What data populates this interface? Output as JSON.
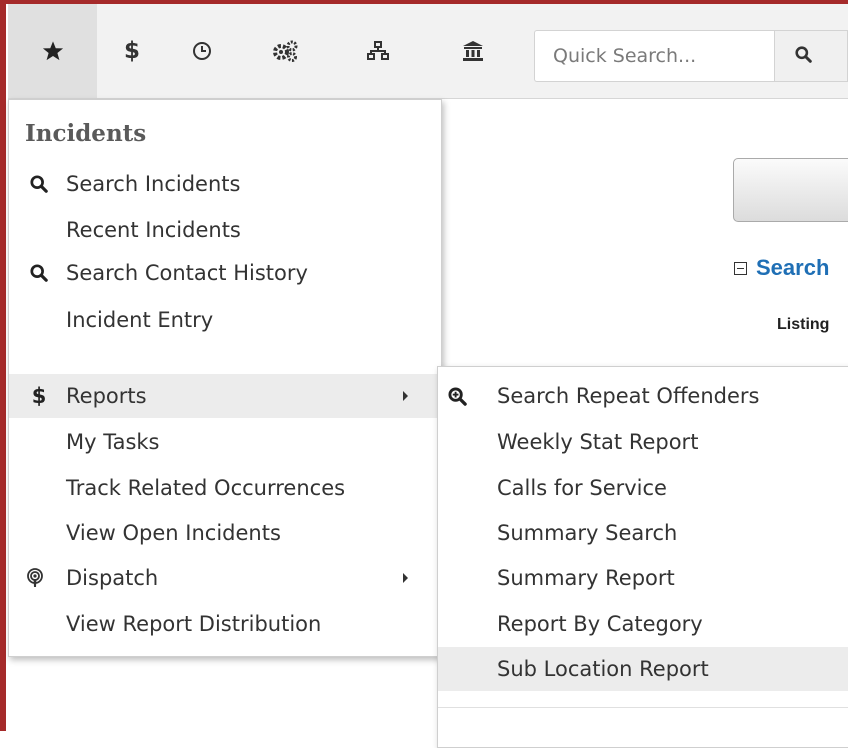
{
  "toolbar": {
    "icons": [
      "star-icon",
      "dollar-icon",
      "clock-icon",
      "cogs-icon",
      "sitemap-icon",
      "institution-icon"
    ],
    "search_placeholder": "Quick Search..."
  },
  "main_menu": {
    "header": "Incidents",
    "items": [
      {
        "label": "Search Incidents",
        "icon": "search-icon"
      },
      {
        "label": "Recent Incidents"
      },
      {
        "label": "Search Contact History",
        "icon": "search-icon"
      },
      {
        "label": "Incident Entry"
      },
      {
        "label": "Reports",
        "icon": "dollar-icon",
        "submenu": true,
        "highlighted": true
      },
      {
        "label": "My Tasks"
      },
      {
        "label": "Track Related Occurrences"
      },
      {
        "label": "View Open Incidents"
      },
      {
        "label": "Dispatch",
        "icon": "podcast-icon",
        "submenu": true
      },
      {
        "label": "View Report Distribution"
      }
    ]
  },
  "reports_submenu": {
    "items": [
      {
        "label": "Search Repeat Offenders",
        "icon": "search-plus-icon"
      },
      {
        "label": "Weekly Stat Report"
      },
      {
        "label": "Calls for Service"
      },
      {
        "label": "Summary Search"
      },
      {
        "label": "Summary Report"
      },
      {
        "label": "Report By Category"
      },
      {
        "label": "Sub Location Report",
        "highlighted": true
      }
    ]
  },
  "page": {
    "search_link": "Search",
    "listing_label": "Listing"
  },
  "colors": {
    "frame": "#a52a2a",
    "toolbar_bg": "#f2f2f2",
    "link_blue": "#1f6fb5",
    "hover_bg": "#ececec"
  }
}
